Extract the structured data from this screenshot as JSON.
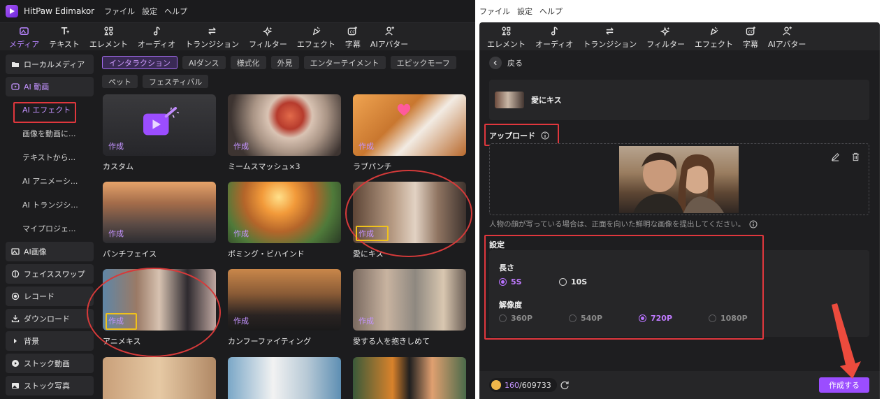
{
  "app": {
    "name": "HitPaw Edimakor",
    "menu": [
      "ファイル",
      "設定",
      "ヘルプ"
    ]
  },
  "toolbar_left": [
    {
      "label": "メディア",
      "icon": "media-icon",
      "active": true
    },
    {
      "label": "テキスト",
      "icon": "text-icon"
    },
    {
      "label": "エレメント",
      "icon": "element-icon"
    },
    {
      "label": "オーディオ",
      "icon": "audio-icon"
    },
    {
      "label": "トランジション",
      "icon": "transition-icon"
    },
    {
      "label": "フィルター",
      "icon": "filter-icon"
    },
    {
      "label": "エフェクト",
      "icon": "effect-icon"
    },
    {
      "label": "字幕",
      "icon": "subtitle-icon"
    },
    {
      "label": "AIアバター",
      "icon": "avatar-icon"
    }
  ],
  "sidebar": {
    "local_media": "ローカルメディア",
    "ai_video": "AI 動画",
    "sub_items": [
      "AI エフェクト",
      "画像を動画に...",
      "テキストから...",
      "AI アニメーシ...",
      "AI トランジシ...",
      "マイプロジェ..."
    ],
    "bottom_items": [
      "AI画像",
      "フェイススワップ",
      "レコード",
      "ダウンロード",
      "背景",
      "ストック動画",
      "ストック写真"
    ]
  },
  "chips_row1": [
    "インタラクション",
    "AIダンス",
    "様式化",
    "外見",
    "エンターテイメント",
    "エピックモーフ"
  ],
  "chips_row2": [
    "ペット",
    "フェスティバル"
  ],
  "make_label": "作成",
  "cards": [
    "カスタム",
    "ミームスマッシュ×3",
    "ラブパンチ",
    "パンチフェイス",
    "ボミング・ビハインド",
    "愛にキス",
    "アニメキス",
    "カンフーファイティング",
    "愛する人を抱きしめて"
  ],
  "right": {
    "menu": [
      "ファイル",
      "設定",
      "ヘルプ"
    ],
    "toolbar": [
      {
        "label": "エレメント",
        "icon": "element-icon"
      },
      {
        "label": "オーディオ",
        "icon": "audio-icon"
      },
      {
        "label": "トランジション",
        "icon": "transition-icon"
      },
      {
        "label": "フィルター",
        "icon": "filter-icon"
      },
      {
        "label": "エフェクト",
        "icon": "effect-icon"
      },
      {
        "label": "字幕",
        "icon": "subtitle-icon"
      },
      {
        "label": "AIアバター",
        "icon": "avatar-icon"
      }
    ],
    "back_label": "戻る",
    "selected_effect": "愛にキス",
    "upload_label": "アップロード",
    "hint": "人物の顔が写っている場合は、正面を向いた鮮明な画像を提出してください。",
    "settings_label": "設定",
    "length_label": "長さ",
    "length_options": [
      "5S",
      "10S"
    ],
    "length_selected": "5S",
    "resolution_label": "解像度",
    "resolution_options": [
      "360P",
      "540P",
      "720P",
      "1080P"
    ],
    "resolution_selected": "720P",
    "credits_used": "160",
    "credits_total": "/609733",
    "create_button": "作成する"
  },
  "colors": {
    "accent": "#9b4dff",
    "annotation_red": "#e0373d",
    "annotation_yellow": "#f0c21b"
  }
}
